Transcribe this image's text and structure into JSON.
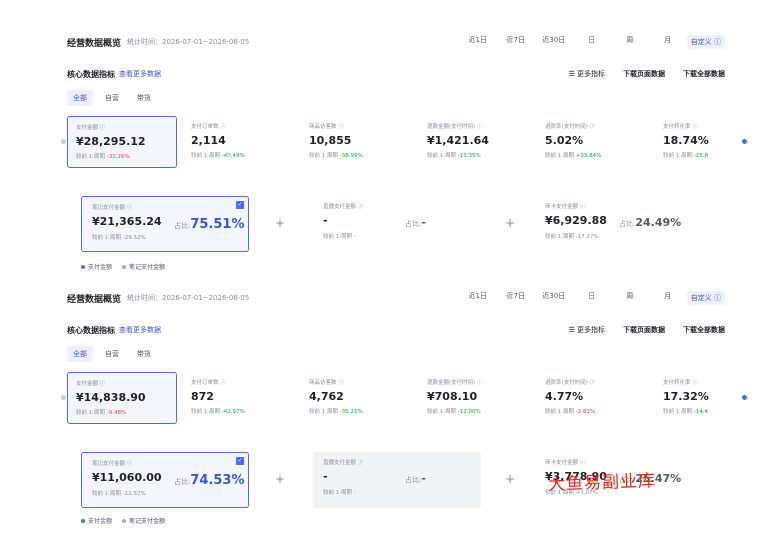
{
  "panels": [
    {
      "title": "经营数据概览",
      "range": "统计时间：2026-07-01~2026-08-05",
      "range_buttons": [
        "近1日",
        "近7日",
        "近30日",
        "日",
        "周",
        "月"
      ],
      "custom_button": "自定义 ⓘ",
      "core_label": "核心数据指标",
      "more_link": "查看更多数据",
      "more_metrics": "☰ 更多指标",
      "download_page": "下载页面数据",
      "download_all": "下载全部数据",
      "filters": [
        "全部",
        "自营",
        "带货"
      ],
      "metrics": [
        {
          "label": "支付金额 ⓘ",
          "value": "¥28,295.12",
          "cmp": "较前 1 周期",
          "delta": "-31.26%",
          "dir": "down"
        },
        {
          "label": "支付订单数 ⓘ",
          "value": "2,114",
          "cmp": "较前 1 周期",
          "delta": "-47.49%",
          "dir": "up"
        },
        {
          "label": "商品访客数 ⓘ",
          "value": "10,855",
          "cmp": "较前 1 周期",
          "delta": "-38.99%",
          "dir": "up"
        },
        {
          "label": "退款金额(支付时间) ⓘ",
          "value": "¥1,421.64",
          "cmp": "较前 1 周期",
          "delta": "-13.35%",
          "dir": "up"
        },
        {
          "label": "退款率(支付时间) ⓘ",
          "value": "5.02%",
          "cmp": "较前 1 周期",
          "delta": "+33.84%",
          "dir": "up"
        },
        {
          "label": "支付转化率 ⓘ",
          "value": "18.74%",
          "cmp": "较前 1 周期",
          "delta": "-15.8",
          "dir": "up"
        }
      ],
      "cards": [
        {
          "label": "笔记支付金额 ⓘ",
          "value": "¥21,365.24",
          "cmp": "较前 1 周期",
          "delta": "-29.52%",
          "share_label": "占比:",
          "share": "75.51%"
        },
        {
          "label": "直播支付金额 ⓘ",
          "value": "-",
          "cmp": "较前 1 周期",
          "delta": "-",
          "share_label": "占比:",
          "share": "-"
        },
        {
          "label": "商卡支付金额 ⓘ",
          "value": "¥6,929.88",
          "cmp": "较前 1 周期",
          "delta": "-17.27%",
          "share_label": "占比:",
          "share": "24.49%"
        }
      ],
      "legend": [
        "支付金额",
        "笔记支付金额"
      ]
    },
    {
      "title": "经营数据概览",
      "range": "统计时间：2026-07-01~2026-08-05",
      "range_buttons": [
        "近1日",
        "近7日",
        "近30日",
        "日",
        "周",
        "月"
      ],
      "custom_button": "自定义 ⓘ",
      "core_label": "核心数据指标",
      "more_link": "查看更多数据",
      "more_metrics": "☰ 更多指标",
      "download_page": "下载页面数据",
      "download_all": "下载全部数据",
      "filters": [
        "全部",
        "自营",
        "带货"
      ],
      "metrics": [
        {
          "label": "支付金额 ⓘ",
          "value": "¥14,838.90",
          "cmp": "较前 1 周期",
          "delta": "-9.48%",
          "dir": "down"
        },
        {
          "label": "支付订单数 ⓘ",
          "value": "872",
          "cmp": "较前 1 周期",
          "delta": "-42.97%",
          "dir": "up"
        },
        {
          "label": "商品访客数 ⓘ",
          "value": "4,762",
          "cmp": "较前 1 周期",
          "delta": "-35.21%",
          "dir": "up"
        },
        {
          "label": "退款金额(支付时间) ⓘ",
          "value": "¥708.10",
          "cmp": "较前 1 周期",
          "delta": "-12.00%",
          "dir": "up"
        },
        {
          "label": "退款率(支付时间) ⓘ",
          "value": "4.77%",
          "cmp": "较前 1 周期",
          "delta": "-2.81%",
          "dir": "down"
        },
        {
          "label": "支付转化率 ⓘ",
          "value": "17.32%",
          "cmp": "较前 1 周期",
          "delta": "-14.4",
          "dir": "up"
        }
      ],
      "cards": [
        {
          "label": "笔记支付金额 ⓘ",
          "value": "¥11,060.00",
          "cmp": "较前 1 周期",
          "delta": "-12.57%",
          "share_label": "占比:",
          "share": "74.53%"
        },
        {
          "label": "直播支付金额 ⓘ",
          "value": "-",
          "cmp": "较前 1 周期",
          "delta": "-",
          "share_label": "占比:",
          "share": "-"
        },
        {
          "label": "商卡支付金额 ⓘ",
          "value": "¥3,778.90",
          "cmp": "较前 1 周期",
          "delta": "+1.07%",
          "share_label": "占比:",
          "share": "25.47%"
        }
      ],
      "legend": [
        "支付金额",
        "笔记支付金额"
      ]
    }
  ],
  "watermark": "大鱼易副业库",
  "colors": {
    "accent": "#4a6cf7",
    "up": "#00b42a",
    "down": "#f53f3f",
    "legend2": "#a9b2c3"
  }
}
